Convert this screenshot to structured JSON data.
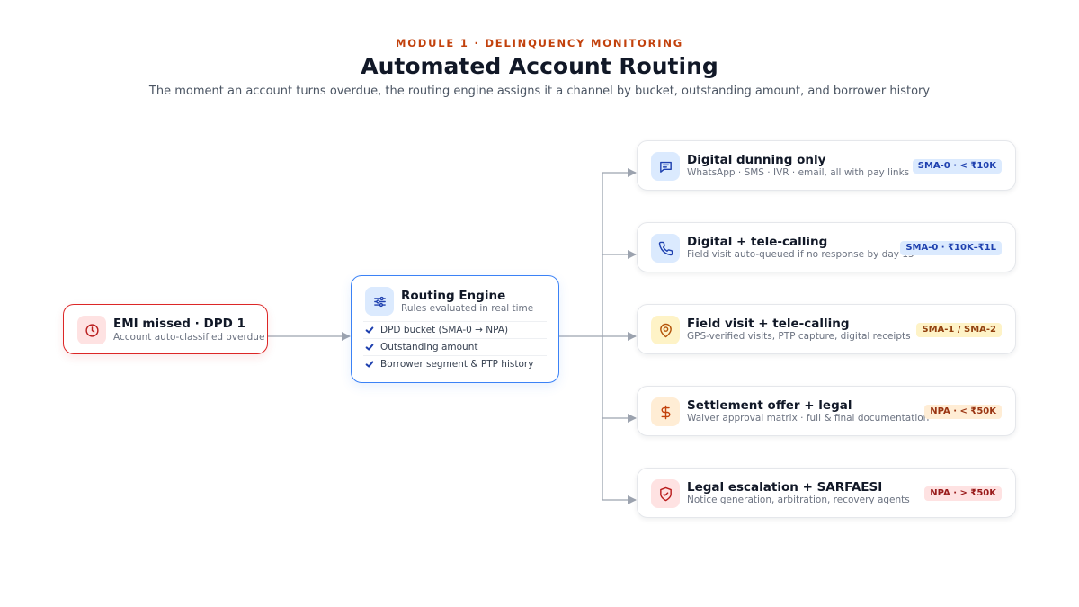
{
  "header": {
    "kicker": "MODULE 1 · DELINQUENCY MONITORING",
    "title": "Automated Account Routing",
    "subtitle": "The moment an account turns overdue, the routing engine assigns it a channel by bucket, outstanding amount, and borrower history"
  },
  "trigger": {
    "title": "EMI missed · DPD 1",
    "subtitle": "Account auto-classified overdue",
    "icon": "clock-icon",
    "accent": "#dc2626"
  },
  "engine": {
    "title": "Routing Engine",
    "subtitle": "Rules evaluated in real time",
    "icon": "sliders-icon",
    "accent": "#3b82f6",
    "rules": [
      "DPD bucket (SMA-0 → NPA)",
      "Outstanding amount",
      "Borrower segment & PTP history"
    ]
  },
  "outcomes": [
    {
      "title": "Digital dunning only",
      "subtitle": "WhatsApp · SMS · IVR · email, all with pay links",
      "badge": "SMA-0 · < ₹10K",
      "icon": "message-icon",
      "icon_bg": "#dbeafe",
      "icon_color": "#1e40af",
      "badge_bg": "#dbeafe",
      "badge_color": "#1e40af"
    },
    {
      "title": "Digital + tele-calling",
      "subtitle": "Field visit auto-queued if no response by day 15",
      "badge": "SMA-0 · ₹10K–₹1L",
      "icon": "phone-icon",
      "icon_bg": "#dbeafe",
      "icon_color": "#1e40af",
      "badge_bg": "#dbeafe",
      "badge_color": "#1e40af"
    },
    {
      "title": "Field visit + tele-calling",
      "subtitle": "GPS-verified visits, PTP capture, digital receipts",
      "badge": "SMA-1 / SMA-2",
      "icon": "map-pin-icon",
      "icon_bg": "#fef3c7",
      "icon_color": "#b45309",
      "badge_bg": "#fef3c7",
      "badge_color": "#92400e"
    },
    {
      "title": "Settlement offer + legal",
      "subtitle": "Waiver approval matrix · full & final documentation",
      "badge": "NPA · < ₹50K",
      "icon": "dollar-icon",
      "icon_bg": "#ffedd5",
      "icon_color": "#c2410c",
      "badge_bg": "#ffedd5",
      "badge_color": "#9a3412"
    },
    {
      "title": "Legal escalation + SARFAESI",
      "subtitle": "Notice generation, arbitration, recovery agents",
      "badge": "NPA · > ₹50K",
      "icon": "shield-check-icon",
      "icon_bg": "#fee2e2",
      "icon_color": "#b91c1c",
      "badge_bg": "#fee2e2",
      "badge_color": "#991b1b"
    }
  ],
  "connector_color": "#9ca3af"
}
